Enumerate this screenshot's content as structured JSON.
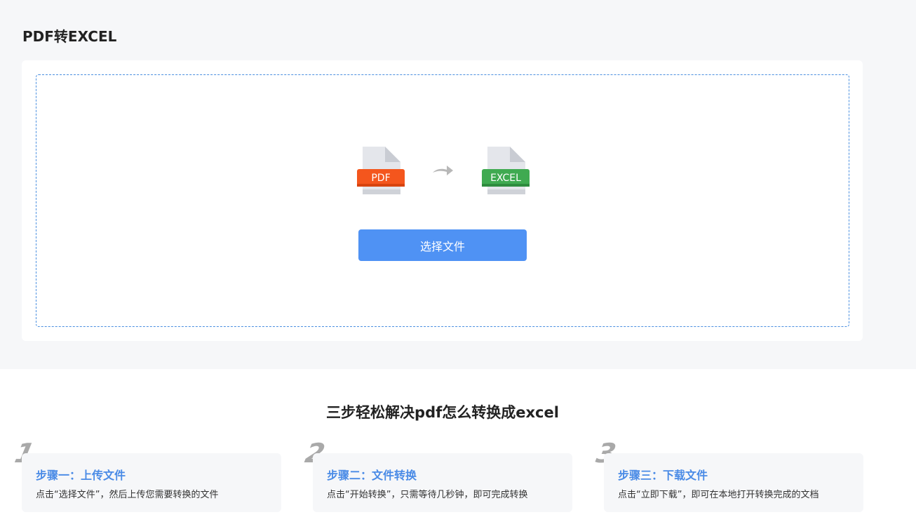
{
  "page": {
    "title": "PDF转EXCEL"
  },
  "upload": {
    "pdf_label": "PDF",
    "excel_label": "EXCEL",
    "select_button": "选择文件",
    "colors": {
      "pdf_band": "#f4561d",
      "excel_band": "#3faa51",
      "button": "#4f92f4",
      "dashed_border": "#4a8fe0"
    }
  },
  "steps_section": {
    "title": "三步轻松解决pdf怎么转换成excel",
    "steps": [
      {
        "number": "1",
        "title": "步骤一：上传文件",
        "description": "点击“选择文件”，然后上传您需要转换的文件"
      },
      {
        "number": "2",
        "title": "步骤二：文件转换",
        "description": "点击“开始转换”，只需等待几秒钟，即可完成转换"
      },
      {
        "number": "3",
        "title": "步骤三：下载文件",
        "description": "点击“立即下载”，即可在本地打开转换完成的文档"
      }
    ]
  }
}
